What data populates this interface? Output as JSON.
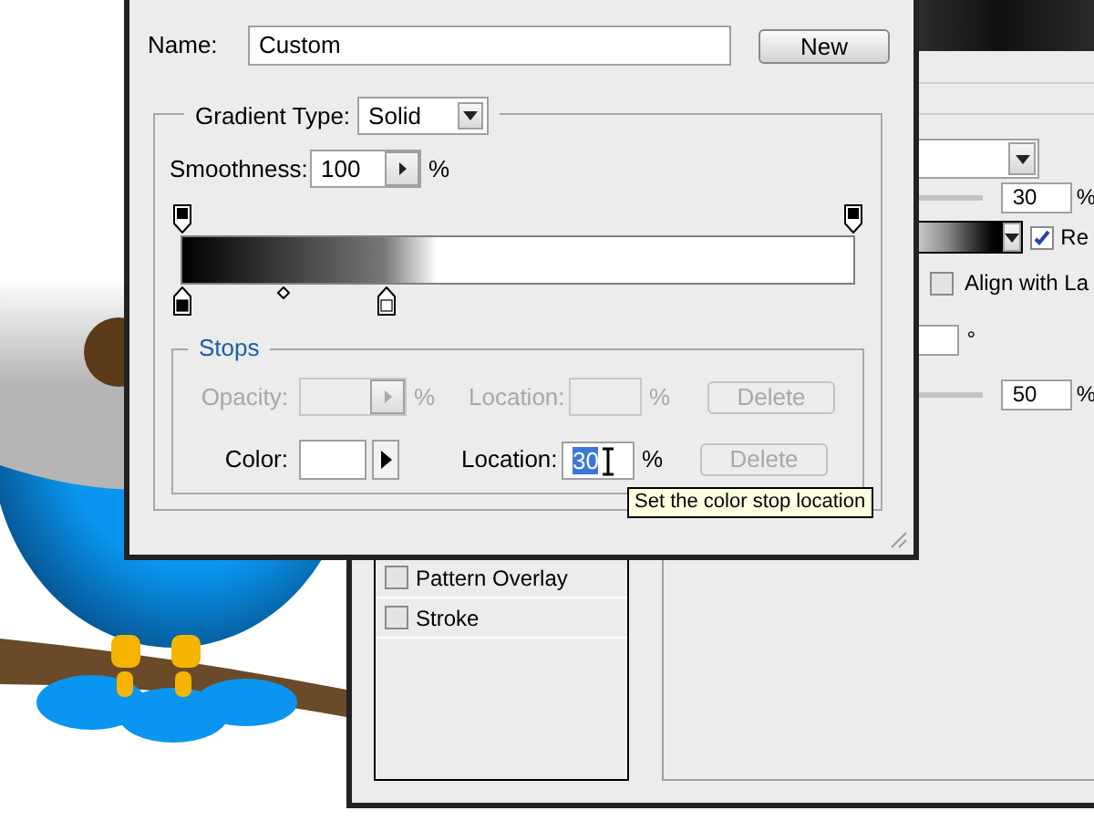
{
  "layer_style": {
    "styles": [
      {
        "label": "Pattern Overlay",
        "checked": false
      },
      {
        "label": "Stroke",
        "checked": false
      }
    ],
    "first_amount": {
      "value": "30",
      "unit": "%"
    },
    "reverse_checkbox": {
      "label": "Re",
      "checked": true
    },
    "align_checkbox": {
      "label": "Align with La",
      "checked": false
    },
    "angle_unit": "°",
    "second_amount": {
      "value": "50",
      "unit": "%"
    }
  },
  "gradient_editor": {
    "name_label": "Name:",
    "name_value": "Custom",
    "new_button": "New",
    "gradient_type_label": "Gradient Type:",
    "gradient_type_value": "Solid",
    "smoothness_label": "Smoothness:",
    "smoothness_value": "100",
    "smoothness_unit": "%",
    "stops": {
      "title": "Stops",
      "opacity_row": {
        "label": "Opacity:",
        "unit": "%",
        "location_label": "Location:",
        "location_unit": "%",
        "delete": "Delete",
        "disabled": true
      },
      "color_row": {
        "label": "Color:",
        "location_label": "Location:",
        "location_value": "30",
        "value_selected": true,
        "location_unit": "%",
        "delete": "Delete",
        "delete_disabled": true
      }
    }
  },
  "tooltip": "Set the color stop location"
}
